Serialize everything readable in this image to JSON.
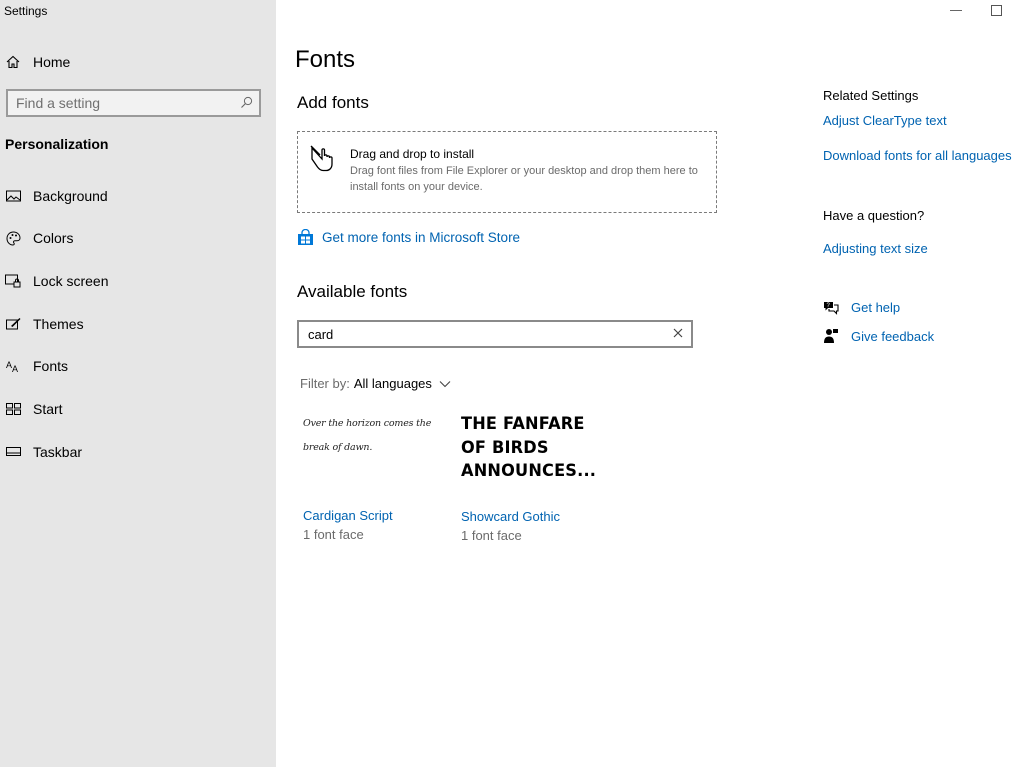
{
  "window": {
    "title": "Settings"
  },
  "sidebar": {
    "home_label": "Home",
    "search_placeholder": "Find a setting",
    "section": "Personalization",
    "items": [
      {
        "label": "Background",
        "icon": "picture-icon"
      },
      {
        "label": "Colors",
        "icon": "palette-icon"
      },
      {
        "label": "Lock screen",
        "icon": "lock-screen-icon"
      },
      {
        "label": "Themes",
        "icon": "themes-icon"
      },
      {
        "label": "Fonts",
        "icon": "fonts-icon"
      },
      {
        "label": "Start",
        "icon": "start-icon"
      },
      {
        "label": "Taskbar",
        "icon": "taskbar-icon"
      }
    ]
  },
  "main": {
    "title": "Fonts",
    "add_fonts": {
      "heading": "Add fonts",
      "drop_title": "Drag and drop to install",
      "drop_desc": "Drag font files from File Explorer or your desktop and drop them here to install fonts on your device.",
      "store_link": "Get more fonts in Microsoft Store"
    },
    "available": {
      "heading": "Available fonts",
      "search_value": "card",
      "filter_label": "Filter by:",
      "filter_value": "All languages",
      "fonts": [
        {
          "preview": "Over the horizon comes the break of dawn.",
          "name": "Cardigan Script",
          "faces": "1 font face"
        },
        {
          "preview": "THE FANFARE OF BIRDS ANNOUNCES...",
          "name": "Showcard Gothic",
          "faces": "1 font face"
        }
      ]
    }
  },
  "related": {
    "heading": "Related Settings",
    "links": [
      "Adjust ClearType text",
      "Download fonts for all languages"
    ],
    "question_heading": "Have a question?",
    "question_link": "Adjusting text size",
    "get_help": "Get help",
    "give_feedback": "Give feedback"
  },
  "colors": {
    "accent": "#0063b1",
    "sidebar_bg": "#e6e6e6"
  }
}
